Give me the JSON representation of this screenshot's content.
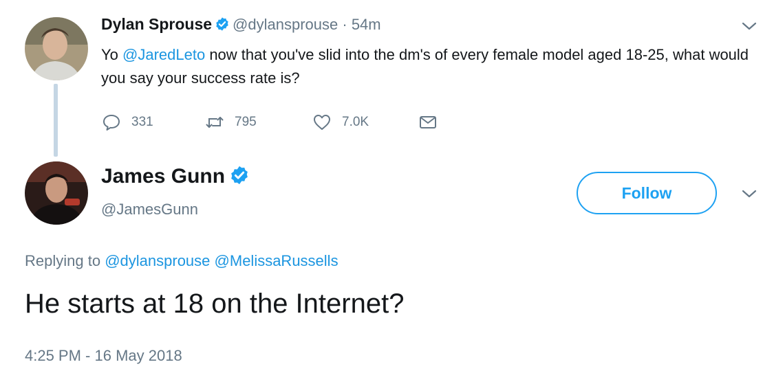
{
  "parent_tweet": {
    "author_name": "Dylan Sprouse",
    "handle": "@dylansprouse",
    "separator": " · ",
    "time": "54m",
    "text_prefix": "Yo ",
    "mention": "@JaredLeto",
    "text_suffix": " now that you've slid into the dm's of every female model aged 18-25, what would you say your success rate is?",
    "actions": {
      "replies": "331",
      "retweets": "795",
      "likes": "7.0K"
    }
  },
  "main_tweet": {
    "author_name": "James Gunn",
    "handle": "@JamesGunn",
    "follow_label": "Follow",
    "replying_prefix": "Replying to",
    "replying_to": [
      "@dylansprouse",
      "@MelissaRussells"
    ],
    "text": "He starts at 18 on the Internet?",
    "timestamp": "4:25 PM - 16 May 2018"
  },
  "colors": {
    "link": "#1b95e0",
    "verified": "#1da1f2",
    "muted": "#657786",
    "thread_line": "#c5d6e4"
  },
  "icons": {
    "reply": "reply-bubble-icon",
    "retweet": "retweet-icon",
    "like": "heart-icon",
    "dm": "envelope-icon",
    "verified": "verified-badge-icon",
    "caret": "chevron-down-icon"
  }
}
